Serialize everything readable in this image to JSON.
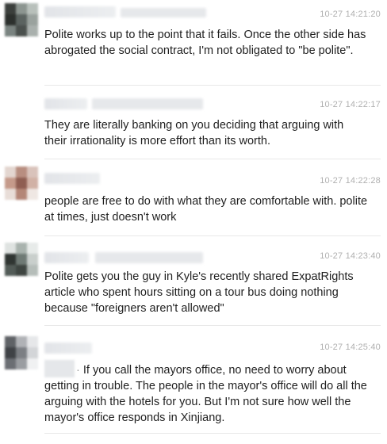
{
  "comments": [
    {
      "timestamp": "10-27 14:21:20",
      "text": "Polite works up to the point that it fails. Once the other side has abrogated the social contract, I'm not obligated to \"be polite\"."
    },
    {
      "timestamp": "10-27 14:22:17",
      "text": "They are literally banking on you deciding that arguing with their irrationality is more effort than its worth."
    },
    {
      "timestamp": "10-27 14:22:28",
      "text": "people are free to do with what they are comfortable with. polite at times,  just doesn't work"
    },
    {
      "timestamp": "10-27 14:23:40",
      "text": "Polite gets you the guy in Kyle's recently shared ExpatRights article who spent hours sitting on a tour bus doing nothing because \"foreigners aren't allowed\""
    },
    {
      "timestamp": "10-27 14:25:40",
      "mention_prefix": "·",
      "text": " If you call the mayors office, no need to worry about getting in trouble. The people in the mayor's office will do all the arguing with the hotels for you. But I'm not sure how well the mayor's office responds in Xinjiang."
    }
  ]
}
